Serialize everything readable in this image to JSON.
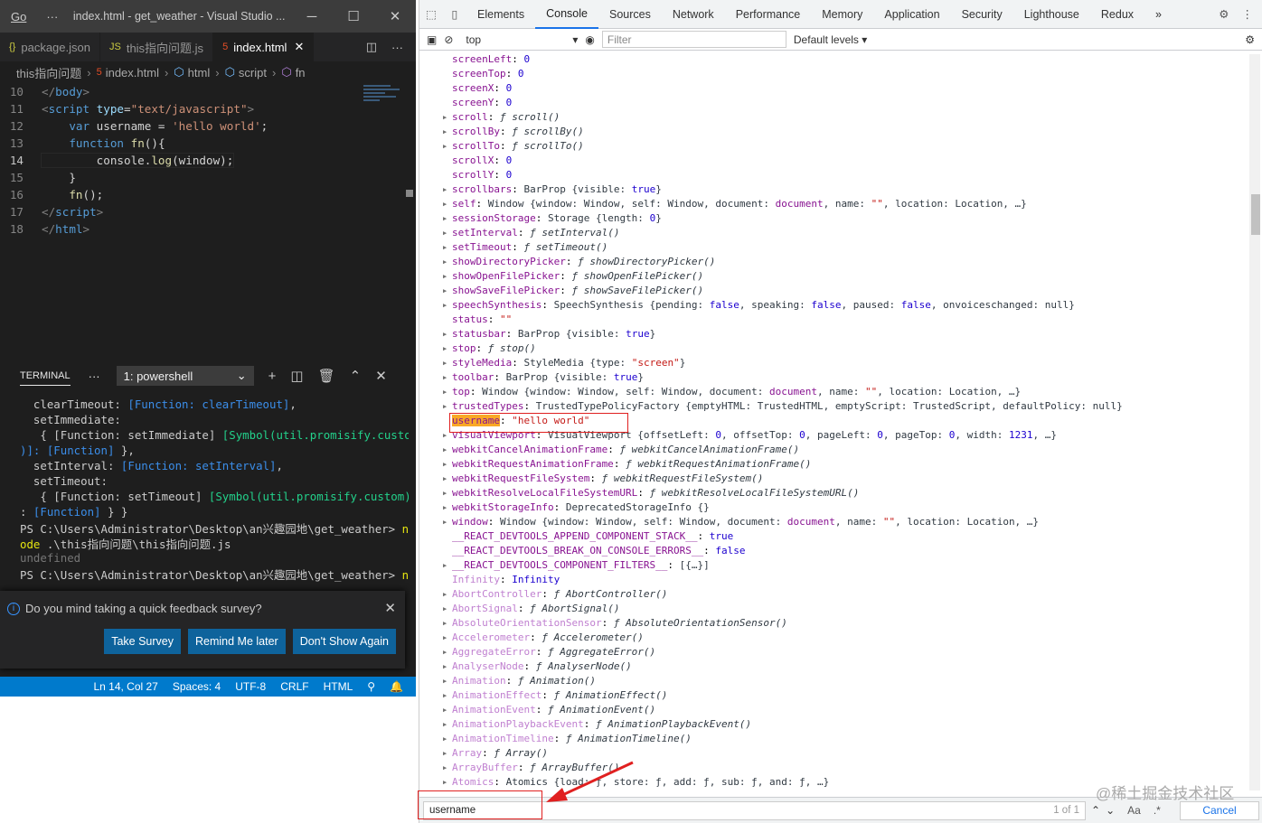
{
  "vscode": {
    "menu": "Go",
    "more": "···",
    "title": "index.html - get_weather - Visual Studio ...",
    "win_min": "─",
    "win_max": "☐",
    "win_close": "✕",
    "tabs": [
      {
        "label": "package.json",
        "icon": "{}"
      },
      {
        "label": "this指向问题.js",
        "icon": "JS"
      },
      {
        "label": "index.html",
        "icon": "5"
      }
    ],
    "tab_close": "✕",
    "split": "◫",
    "tab_more": "···",
    "crumbs": [
      "this指向问题",
      "index.html",
      "html",
      "script",
      "fn"
    ],
    "code_lines": [
      {
        "n": "10",
        "html": "<span class='t'>&lt;/</span><span class='tg'>body</span><span class='t'>&gt;</span>"
      },
      {
        "n": "11",
        "html": "<span class='t'>&lt;</span><span class='tg'>script</span> <span class='at'>type</span>=<span class='s'>\"text/javascript\"</span><span class='t'>&gt;</span>"
      },
      {
        "n": "12",
        "html": "    <span class='k'>var</span> username = <span class='s'>'hello world'</span>;"
      },
      {
        "n": "13",
        "html": "    <span class='k'>function</span> <span class='fn'>fn</span>(){"
      },
      {
        "n": "14",
        "html": "        console.<span class='fn'>log</span>(window);"
      },
      {
        "n": "15",
        "html": "    }"
      },
      {
        "n": "16",
        "html": "    <span class='fn'>fn</span>();"
      },
      {
        "n": "17",
        "html": "<span class='t'>&lt;/</span><span class='tg'>script</span><span class='t'>&gt;</span>"
      },
      {
        "n": "18",
        "html": "<span class='t'>&lt;/</span><span class='tg'>html</span><span class='t'>&gt;</span>"
      }
    ],
    "terminal_tab": "TERMINAL",
    "terminal_more": "···",
    "terminal_select": "1: powershell",
    "terminal_actions": [
      "+",
      "◫",
      "🗑",
      "⌃",
      "✕"
    ],
    "terminal_lines": [
      "  clearTimeout: <span class='tc'>[Function: clearTimeout]</span>,",
      "  setImmediate:",
      "   { [Function: setImmediate] <span class='tg2'>[Symbol(util.promisify.custom</span>",
      "<span class='tc'>)]: [Function]</span> },",
      "  setInterval: <span class='tc'>[Function: setInterval]</span>,",
      "  setTimeout:",
      "   { [Function: setTimeout] <span class='tg2'>[Symbol(util.promisify.custom)]</span>",
      ": <span class='tc'>[Function]</span> } }",
      "PS C:\\Users\\Administrator\\Desktop\\an兴趣园地\\get_weather&gt; <span class='yel'>n</span>",
      "<span class='yel'>ode</span> .\\this指向问题\\this指向问题.js",
      "<span class='gray'>undefined</span>",
      "PS C:\\Users\\Administrator\\Desktop\\an兴趣园地\\get_weather&gt; <span class='yel'>n</span>"
    ],
    "toast": {
      "message": "Do you mind taking a quick feedback survey?",
      "info": "i",
      "close": "✕",
      "buttons": [
        "Take Survey",
        "Remind Me later",
        "Don't Show Again"
      ]
    },
    "status": [
      "Ln 14, Col 27",
      "Spaces: 4",
      "UTF-8",
      "CRLF",
      "HTML",
      "⚲",
      "🔔"
    ]
  },
  "devtools": {
    "tabs": [
      "Elements",
      "Console",
      "Sources",
      "Network",
      "Performance",
      "Memory",
      "Application",
      "Security",
      "Lighthouse",
      "Redux"
    ],
    "active_tab": "Console",
    "more_tabs": "»",
    "settings": "⚙",
    "kebab": "⋮",
    "context": "top",
    "filter_placeholder": "Filter",
    "levels": "Default levels ▾",
    "console_lines": [
      {
        "e": false,
        "h": "<span class='pk'>screenLeft</span>: <span class='vn'>0</span>"
      },
      {
        "e": false,
        "h": "<span class='pk'>screenTop</span>: <span class='vn'>0</span>"
      },
      {
        "e": false,
        "h": "<span class='pk'>screenX</span>: <span class='vn'>0</span>"
      },
      {
        "e": false,
        "h": "<span class='pk'>screenY</span>: <span class='vn'>0</span>"
      },
      {
        "e": true,
        "h": "<span class='pk'>scroll</span>: <span class='vf'>ƒ scroll()</span>"
      },
      {
        "e": true,
        "h": "<span class='pk'>scrollBy</span>: <span class='vf'>ƒ scrollBy()</span>"
      },
      {
        "e": true,
        "h": "<span class='pk'>scrollTo</span>: <span class='vf'>ƒ scrollTo()</span>"
      },
      {
        "e": false,
        "h": "<span class='pk'>scrollX</span>: <span class='vn'>0</span>"
      },
      {
        "e": false,
        "h": "<span class='pk'>scrollY</span>: <span class='vn'>0</span>"
      },
      {
        "e": true,
        "h": "<span class='pk'>scrollbars</span>: <span class='vo'>BarProp {visible: <span class='vn'>true</span>}</span>"
      },
      {
        "e": true,
        "h": "<span class='pk'>self</span>: <span class='vo'>Window {window: Window, self: Window, document: <span class='pk'>document</span>, name: <span class='vs'>\"\"</span>, location: Location, …}</span>"
      },
      {
        "e": true,
        "h": "<span class='pk'>sessionStorage</span>: <span class='vo'>Storage {length: <span class='vn'>0</span>}</span>"
      },
      {
        "e": true,
        "h": "<span class='pk'>setInterval</span>: <span class='vf'>ƒ setInterval()</span>"
      },
      {
        "e": true,
        "h": "<span class='pk'>setTimeout</span>: <span class='vf'>ƒ setTimeout()</span>"
      },
      {
        "e": true,
        "h": "<span class='pk'>showDirectoryPicker</span>: <span class='vf'>ƒ showDirectoryPicker()</span>"
      },
      {
        "e": true,
        "h": "<span class='pk'>showOpenFilePicker</span>: <span class='vf'>ƒ showOpenFilePicker()</span>"
      },
      {
        "e": true,
        "h": "<span class='pk'>showSaveFilePicker</span>: <span class='vf'>ƒ showSaveFilePicker()</span>"
      },
      {
        "e": true,
        "h": "<span class='pk'>speechSynthesis</span>: <span class='vo'>SpeechSynthesis {pending: <span class='vn'>false</span>, speaking: <span class='vn'>false</span>, paused: <span class='vn'>false</span>, onvoiceschanged: null}</span>"
      },
      {
        "e": false,
        "h": "<span class='pk'>status</span>: <span class='vs'>\"\"</span>"
      },
      {
        "e": true,
        "h": "<span class='pk'>statusbar</span>: <span class='vo'>BarProp {visible: <span class='vn'>true</span>}</span>"
      },
      {
        "e": true,
        "h": "<span class='pk'>stop</span>: <span class='vf'>ƒ stop()</span>"
      },
      {
        "e": true,
        "h": "<span class='pk'>styleMedia</span>: <span class='vo'>StyleMedia {type: <span class='vs'>\"screen\"</span>}</span>"
      },
      {
        "e": true,
        "h": "<span class='pk'>toolbar</span>: <span class='vo'>BarProp {visible: <span class='vn'>true</span>}</span>"
      },
      {
        "e": true,
        "h": "<span class='pk'>top</span>: <span class='vo'>Window {window: Window, self: Window, document: <span class='pk'>document</span>, name: <span class='vs'>\"\"</span>, location: Location, …}</span>"
      },
      {
        "e": true,
        "h": "<span class='pk'>trustedTypes</span>: <span class='vo'>TrustedTypePolicyFactory {emptyHTML: TrustedHTML, emptyScript: TrustedScript, defaultPolicy: null}</span>"
      },
      {
        "e": false,
        "h": "<span class='hl'>username</span>: <span class='vs'>\"hello world\"</span>"
      },
      {
        "e": true,
        "h": "<span class='pk'>visualViewport</span>: <span class='vo'>VisualViewport {offsetLeft: <span class='vn'>0</span>, offsetTop: <span class='vn'>0</span>, pageLeft: <span class='vn'>0</span>, pageTop: <span class='vn'>0</span>, width: <span class='vn'>1231</span>, …}</span>"
      },
      {
        "e": true,
        "h": "<span class='pk'>webkitCancelAnimationFrame</span>: <span class='vf'>ƒ webkitCancelAnimationFrame()</span>"
      },
      {
        "e": true,
        "h": "<span class='pk'>webkitRequestAnimationFrame</span>: <span class='vf'>ƒ webkitRequestAnimationFrame()</span>"
      },
      {
        "e": true,
        "h": "<span class='pk'>webkitRequestFileSystem</span>: <span class='vf'>ƒ webkitRequestFileSystem()</span>"
      },
      {
        "e": true,
        "h": "<span class='pk'>webkitResolveLocalFileSystemURL</span>: <span class='vf'>ƒ webkitResolveLocalFileSystemURL()</span>"
      },
      {
        "e": true,
        "h": "<span class='pk'>webkitStorageInfo</span>: <span class='vo'>DeprecatedStorageInfo {}</span>"
      },
      {
        "e": true,
        "h": "<span class='pk'>window</span>: <span class='vo'>Window {window: Window, self: Window, document: <span class='pk'>document</span>, name: <span class='vs'>\"\"</span>, location: Location, …}</span>"
      },
      {
        "e": false,
        "h": "<span class='pk'>__REACT_DEVTOOLS_APPEND_COMPONENT_STACK__</span>: <span class='vn'>true</span>"
      },
      {
        "e": false,
        "h": "<span class='pk'>__REACT_DEVTOOLS_BREAK_ON_CONSOLE_ERRORS__</span>: <span class='vn'>false</span>"
      },
      {
        "e": true,
        "h": "<span class='pk'>__REACT_DEVTOOLS_COMPONENT_FILTERS__</span>: <span class='vo'>[{…}]</span>"
      },
      {
        "e": false,
        "h": "<span class='pg'>Infinity</span>: <span class='vn'>Infinity</span>"
      },
      {
        "e": true,
        "h": "<span class='pg'>AbortController</span>: <span class='vf'>ƒ AbortController()</span>"
      },
      {
        "e": true,
        "h": "<span class='pg'>AbortSignal</span>: <span class='vf'>ƒ AbortSignal()</span>"
      },
      {
        "e": true,
        "h": "<span class='pg'>AbsoluteOrientationSensor</span>: <span class='vf'>ƒ AbsoluteOrientationSensor()</span>"
      },
      {
        "e": true,
        "h": "<span class='pg'>Accelerometer</span>: <span class='vf'>ƒ Accelerometer()</span>"
      },
      {
        "e": true,
        "h": "<span class='pg'>AggregateError</span>: <span class='vf'>ƒ AggregateError()</span>"
      },
      {
        "e": true,
        "h": "<span class='pg'>AnalyserNode</span>: <span class='vf'>ƒ AnalyserNode()</span>"
      },
      {
        "e": true,
        "h": "<span class='pg'>Animation</span>: <span class='vf'>ƒ Animation()</span>"
      },
      {
        "e": true,
        "h": "<span class='pg'>AnimationEffect</span>: <span class='vf'>ƒ AnimationEffect()</span>"
      },
      {
        "e": true,
        "h": "<span class='pg'>AnimationEvent</span>: <span class='vf'>ƒ AnimationEvent()</span>"
      },
      {
        "e": true,
        "h": "<span class='pg'>AnimationPlaybackEvent</span>: <span class='vf'>ƒ AnimationPlaybackEvent()</span>"
      },
      {
        "e": true,
        "h": "<span class='pg'>AnimationTimeline</span>: <span class='vf'>ƒ AnimationTimeline()</span>"
      },
      {
        "e": true,
        "h": "<span class='pg'>Array</span>: <span class='vf'>ƒ Array()</span>"
      },
      {
        "e": true,
        "h": "<span class='pg'>ArrayBuffer</span>: <span class='vf'>ƒ ArrayBuffer()</span>"
      },
      {
        "e": true,
        "h": "<span class='pg'>Atomics</span>: <span class='vo'>Atomics {load: ƒ, store: ƒ, add: ƒ, sub: ƒ, and: ƒ, …}</span>"
      }
    ],
    "search": {
      "value": "username",
      "count": "1 of 1",
      "up": "⌃",
      "down": "⌄",
      "case": "Aa",
      "regex": ".*",
      "cancel": "Cancel"
    }
  },
  "watermark": "@稀土掘金技术社区"
}
